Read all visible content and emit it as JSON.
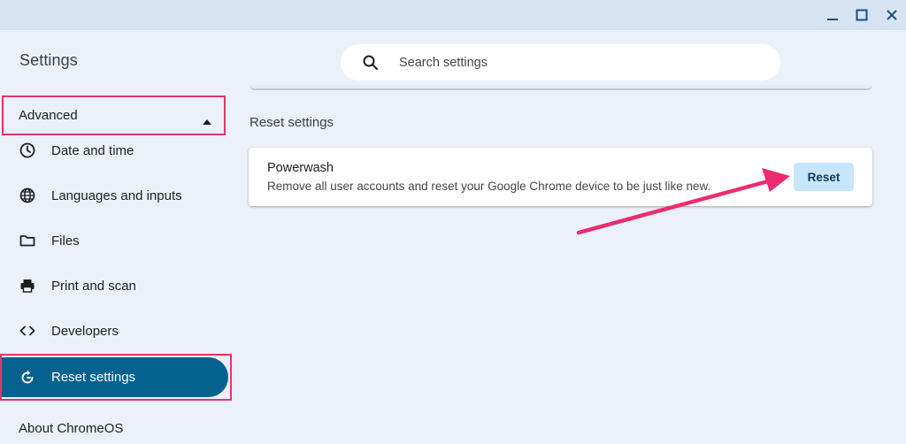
{
  "app": {
    "title": "Settings"
  },
  "window_controls": [
    "minimize-icon",
    "maximize-icon",
    "close-icon"
  ],
  "search": {
    "placeholder": "Search settings",
    "icon": "search-icon"
  },
  "sidebar": {
    "section": {
      "label": "Advanced",
      "expanded": true
    },
    "items": [
      {
        "label": "Date and time",
        "icon": "clock-icon"
      },
      {
        "label": "Languages and inputs",
        "icon": "globe-icon"
      },
      {
        "label": "Files",
        "icon": "folder-icon"
      },
      {
        "label": "Print and scan",
        "icon": "printer-icon"
      },
      {
        "label": "Developers",
        "icon": "code-icon"
      },
      {
        "label": "Reset settings",
        "icon": "reset-icon",
        "active": true
      }
    ],
    "about": "About ChromeOS"
  },
  "main": {
    "section_title": "Reset settings",
    "powerwash": {
      "title": "Powerwash",
      "description": "Remove all user accounts and reset your Google Chrome device to be just like new.",
      "button_label": "Reset"
    }
  },
  "colors": {
    "accent": "#05628f",
    "highlight": "#e8336b",
    "button_bg": "#c8e6fb",
    "background": "#ecf1f9"
  }
}
